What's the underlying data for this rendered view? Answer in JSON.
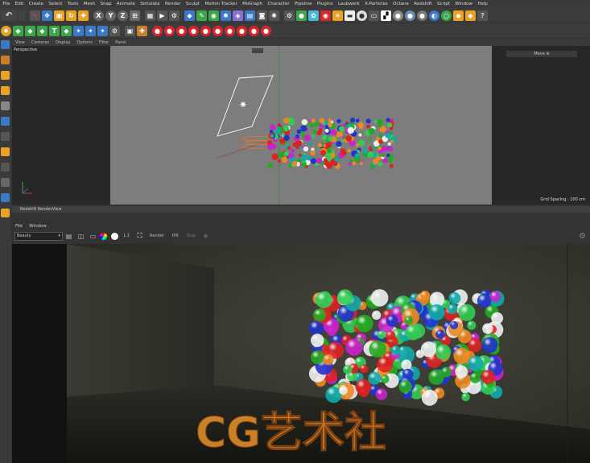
{
  "menubar": [
    "File",
    "Edit",
    "Create",
    "Select",
    "Tools",
    "Mesh",
    "Snap",
    "Animate",
    "Simulate",
    "Render",
    "Sculpt",
    "Motion Tracker",
    "MoGraph",
    "Character",
    "Pipeline",
    "Plugins",
    "Laubwerk",
    "X-Particles",
    "Octane",
    "Redshift",
    "Script",
    "Window",
    "Help"
  ],
  "viewport": {
    "menu": [
      "View",
      "Cameras",
      "Display",
      "Options",
      "Filter",
      "Panel"
    ],
    "label": "Perspective",
    "move_label": "Move",
    "grid_spacing": "Grid Spacing : 100 cm"
  },
  "renderview": {
    "title": "Redshift RenderView",
    "menu": [
      "File",
      "Window"
    ],
    "preset": "Beauty",
    "ratio": "1:1",
    "render_label": "Render",
    "ipr_label": "IPR",
    "stop_label": "Stop"
  },
  "watermark": "CG艺术社",
  "colors": {
    "background": "#333333",
    "viewport": "#7d7d7d",
    "render_bg": "#1c1c1c",
    "accent": "#d9262b"
  }
}
